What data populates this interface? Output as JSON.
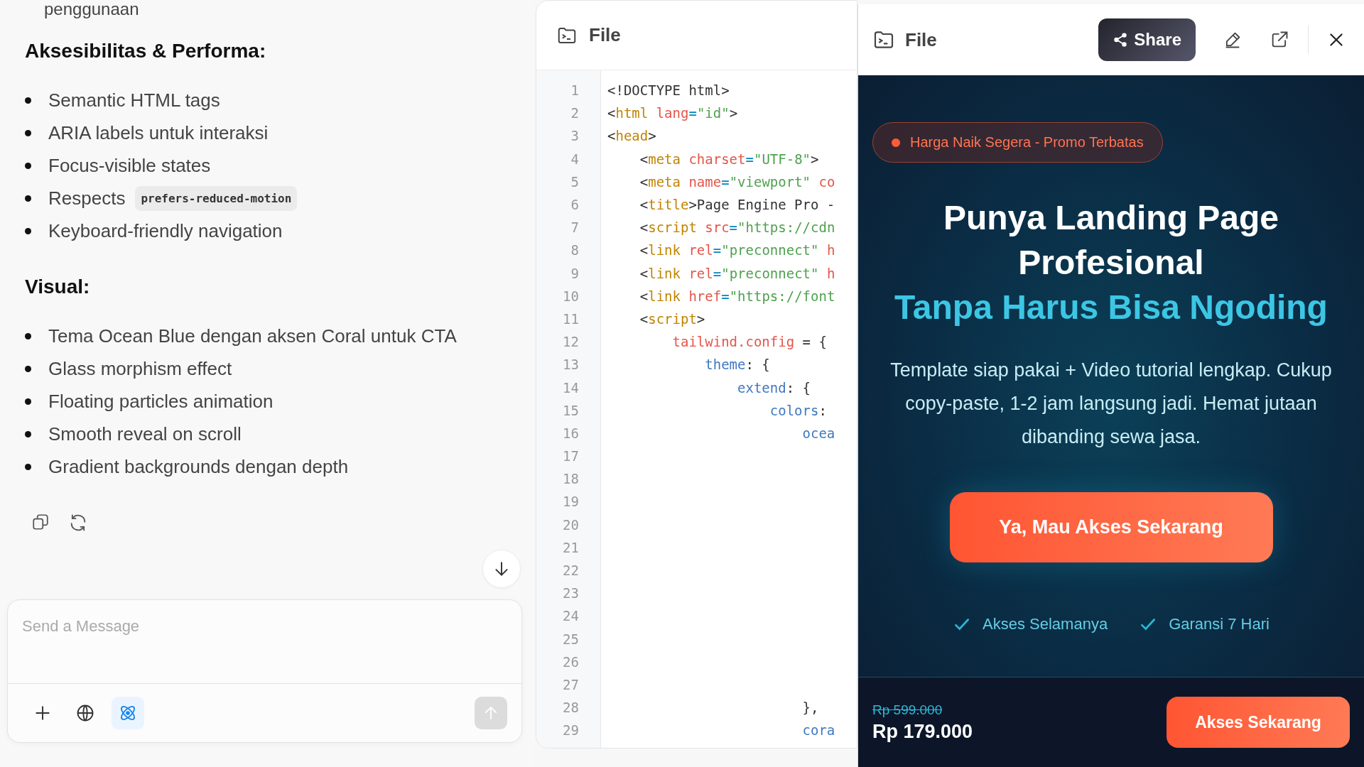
{
  "chat": {
    "intro_fragment": "penggunaan",
    "sections": [
      {
        "heading": "Aksesibilitas & Performa:",
        "items": [
          {
            "text": "Semantic HTML tags"
          },
          {
            "text": "ARIA labels untuk interaksi"
          },
          {
            "text": "Focus-visible states"
          },
          {
            "text": "Respects",
            "code": "prefers-reduced-motion"
          },
          {
            "text": "Keyboard-friendly navigation"
          }
        ]
      },
      {
        "heading": "Visual:",
        "items": [
          {
            "text": "Tema Ocean Blue dengan aksen Coral untuk CTA"
          },
          {
            "text": "Glass morphism effect"
          },
          {
            "text": "Floating particles animation"
          },
          {
            "text": "Smooth reveal on scroll"
          },
          {
            "text": "Gradient backgrounds dengan depth"
          }
        ]
      }
    ],
    "composer": {
      "placeholder": "Send a Message",
      "tools": [
        {
          "kind": "plus",
          "selected": false
        },
        {
          "kind": "globe",
          "selected": false
        },
        {
          "kind": "atom",
          "selected": true
        }
      ]
    }
  },
  "code_panel": {
    "title": "File",
    "lines": [
      {
        "number": "1",
        "tokens": [
          {
            "kind": "punct",
            "text": "<!DOCTYPE html>"
          }
        ]
      },
      {
        "number": "2",
        "tokens": [
          {
            "kind": "punct",
            "text": "<"
          },
          {
            "kind": "tag",
            "text": "html"
          },
          {
            "kind": "attr",
            "text": " lang"
          },
          {
            "kind": "op",
            "text": "="
          },
          {
            "kind": "str",
            "text": "\"id\""
          },
          {
            "kind": "punct",
            "text": ">"
          }
        ]
      },
      {
        "number": "3",
        "tokens": [
          {
            "kind": "punct",
            "text": "<"
          },
          {
            "kind": "tag",
            "text": "head"
          },
          {
            "kind": "punct",
            "text": ">"
          }
        ]
      },
      {
        "number": "4",
        "tokens": [
          {
            "kind": "punct",
            "text": "    <"
          },
          {
            "kind": "tag",
            "text": "meta"
          },
          {
            "kind": "attr",
            "text": " charset"
          },
          {
            "kind": "op",
            "text": "="
          },
          {
            "kind": "str",
            "text": "\"UTF-8\""
          },
          {
            "kind": "punct",
            "text": ">"
          }
        ]
      },
      {
        "number": "5",
        "tokens": [
          {
            "kind": "punct",
            "text": "    <"
          },
          {
            "kind": "tag",
            "text": "meta"
          },
          {
            "kind": "attr",
            "text": " name"
          },
          {
            "kind": "op",
            "text": "="
          },
          {
            "kind": "str",
            "text": "\"viewport\""
          },
          {
            "kind": "attr",
            "text": " co"
          }
        ]
      },
      {
        "number": "6",
        "tokens": [
          {
            "kind": "punct",
            "text": "    <"
          },
          {
            "kind": "tag",
            "text": "title"
          },
          {
            "kind": "punct",
            "text": ">Page Engine Pro -"
          }
        ]
      },
      {
        "number": "7",
        "tokens": [
          {
            "kind": "punct",
            "text": "    <"
          },
          {
            "kind": "tag",
            "text": "script"
          },
          {
            "kind": "attr",
            "text": " src"
          },
          {
            "kind": "op",
            "text": "="
          },
          {
            "kind": "str",
            "text": "\"https://cdn"
          }
        ]
      },
      {
        "number": "8",
        "tokens": [
          {
            "kind": "punct",
            "text": "    <"
          },
          {
            "kind": "tag",
            "text": "link"
          },
          {
            "kind": "attr",
            "text": " rel"
          },
          {
            "kind": "op",
            "text": "="
          },
          {
            "kind": "str",
            "text": "\"preconnect\""
          },
          {
            "kind": "attr",
            "text": " h"
          }
        ]
      },
      {
        "number": "9",
        "tokens": [
          {
            "kind": "punct",
            "text": "    <"
          },
          {
            "kind": "tag",
            "text": "link"
          },
          {
            "kind": "attr",
            "text": " rel"
          },
          {
            "kind": "op",
            "text": "="
          },
          {
            "kind": "str",
            "text": "\"preconnect\""
          },
          {
            "kind": "attr",
            "text": " h"
          }
        ]
      },
      {
        "number": "10",
        "tokens": [
          {
            "kind": "punct",
            "text": "    <"
          },
          {
            "kind": "tag",
            "text": "link"
          },
          {
            "kind": "attr",
            "text": " href"
          },
          {
            "kind": "op",
            "text": "="
          },
          {
            "kind": "str",
            "text": "\"https://font"
          }
        ]
      },
      {
        "number": "11",
        "tokens": [
          {
            "kind": "punct",
            "text": "    <"
          },
          {
            "kind": "tag",
            "text": "script"
          },
          {
            "kind": "punct",
            "text": ">"
          }
        ]
      },
      {
        "number": "12",
        "tokens": [
          {
            "kind": "var",
            "text": "        tailwind.config"
          },
          {
            "kind": "punct",
            "text": " = {"
          }
        ]
      },
      {
        "number": "13",
        "tokens": [
          {
            "kind": "prop",
            "text": "            theme"
          },
          {
            "kind": "punct",
            "text": ": {"
          }
        ]
      },
      {
        "number": "14",
        "tokens": [
          {
            "kind": "prop",
            "text": "                extend"
          },
          {
            "kind": "punct",
            "text": ": {"
          }
        ]
      },
      {
        "number": "15",
        "tokens": [
          {
            "kind": "prop",
            "text": "                    colors"
          },
          {
            "kind": "punct",
            "text": ":"
          }
        ]
      },
      {
        "number": "16",
        "tokens": [
          {
            "kind": "prop",
            "text": "                        ocea"
          }
        ]
      },
      {
        "number": "17"
      },
      {
        "number": "18"
      },
      {
        "number": "19"
      },
      {
        "number": "20"
      },
      {
        "number": "21"
      },
      {
        "number": "22"
      },
      {
        "number": "23"
      },
      {
        "number": "24"
      },
      {
        "number": "25"
      },
      {
        "number": "26"
      },
      {
        "number": "27"
      },
      {
        "number": "28",
        "tokens": [
          {
            "kind": "punct",
            "text": "                        },"
          }
        ]
      },
      {
        "number": "29",
        "tokens": [
          {
            "kind": "prop",
            "text": "                        cora"
          }
        ]
      }
    ]
  },
  "preview_panel": {
    "title": "File",
    "share_label": "Share",
    "page": {
      "badge": "Harga Naik Segera - Promo Terbatas",
      "headline": [
        "Punya Landing Page",
        "Profesional"
      ],
      "headline_accent": "Tanpa Harus Bisa Ngoding",
      "subtitle": "Template siap pakai + Video tutorial lengkap. Cukup copy-paste, 1-2 jam langsung jadi. Hemat jutaan dibanding sewa jasa.",
      "cta": "Ya, Mau Akses Sekarang",
      "guarantees": [
        "Akses Selamanya",
        "Garansi 7 Hari"
      ],
      "old_price": "Rp 599.000",
      "price": "Rp 179.000",
      "footer_cta": "Akses Sekarang"
    }
  }
}
